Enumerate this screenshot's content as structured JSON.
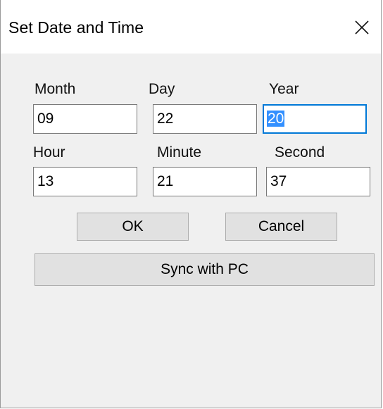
{
  "dialog": {
    "title": "Set Date and Time",
    "close_icon": "close-icon"
  },
  "date": {
    "month_label": "Month",
    "month_value": "09",
    "day_label": "Day",
    "day_value": "22",
    "year_label": "Year",
    "year_value": "20"
  },
  "time": {
    "hour_label": "Hour",
    "hour_value": "13",
    "minute_label": "Minute",
    "minute_value": "21",
    "second_label": "Second",
    "second_value": "37"
  },
  "buttons": {
    "ok_label": "OK",
    "cancel_label": "Cancel",
    "sync_label": "Sync with PC"
  },
  "colors": {
    "selection": "#3390ff",
    "focus_border": "#0078d7"
  }
}
